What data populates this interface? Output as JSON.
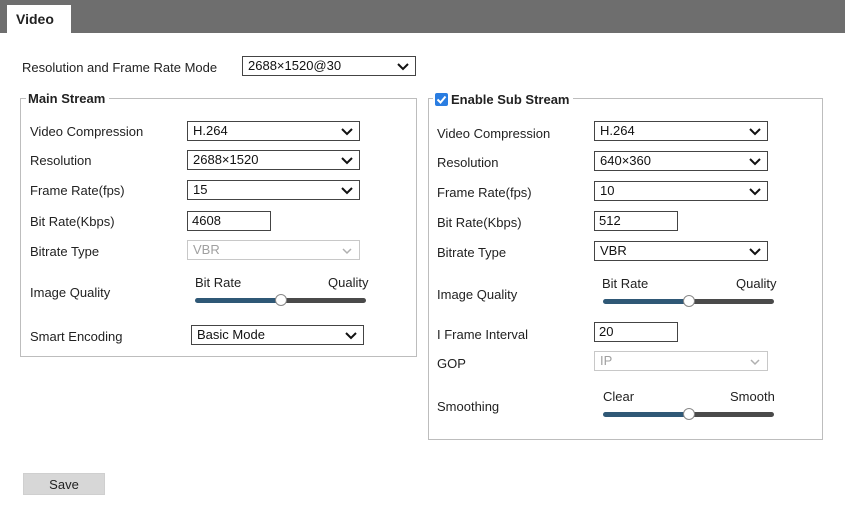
{
  "tab": {
    "label": "Video"
  },
  "colors": {
    "accent": "#2a7de1",
    "slider_fill": "#2f5876",
    "slider_rest": "#4a4a4a",
    "header_bg": "#6e6e6e"
  },
  "mode": {
    "label": "Resolution and Frame Rate Mode",
    "value": "2688×1520@30"
  },
  "main": {
    "title": "Main Stream",
    "video_compression": {
      "label": "Video Compression",
      "value": "H.264"
    },
    "resolution": {
      "label": "Resolution",
      "value": "2688×1520"
    },
    "frame_rate": {
      "label": "Frame Rate(fps)",
      "value": "15"
    },
    "bit_rate": {
      "label": "Bit Rate(Kbps)",
      "value": "4608"
    },
    "bitrate_type": {
      "label": "Bitrate Type",
      "value": "VBR"
    },
    "image_quality": {
      "label": "Image Quality",
      "left": "Bit Rate",
      "right": "Quality",
      "level": 0.5
    },
    "smart_encoding": {
      "label": "Smart Encoding",
      "value": "Basic Mode"
    }
  },
  "sub": {
    "title": "Enable Sub Stream",
    "enabled": true,
    "video_compression": {
      "label": "Video Compression",
      "value": "H.264"
    },
    "resolution": {
      "label": "Resolution",
      "value": "640×360"
    },
    "frame_rate": {
      "label": "Frame Rate(fps)",
      "value": "10"
    },
    "bit_rate": {
      "label": "Bit Rate(Kbps)",
      "value": "512"
    },
    "bitrate_type": {
      "label": "Bitrate Type",
      "value": "VBR"
    },
    "image_quality": {
      "label": "Image Quality",
      "left": "Bit Rate",
      "right": "Quality",
      "level": 0.5
    },
    "i_frame_interval": {
      "label": "I Frame Interval",
      "value": "20"
    },
    "gop": {
      "label": "GOP",
      "value": "IP"
    },
    "smoothing": {
      "label": "Smoothing",
      "left": "Clear",
      "right": "Smooth",
      "level": 0.5
    }
  },
  "save_label": "Save"
}
